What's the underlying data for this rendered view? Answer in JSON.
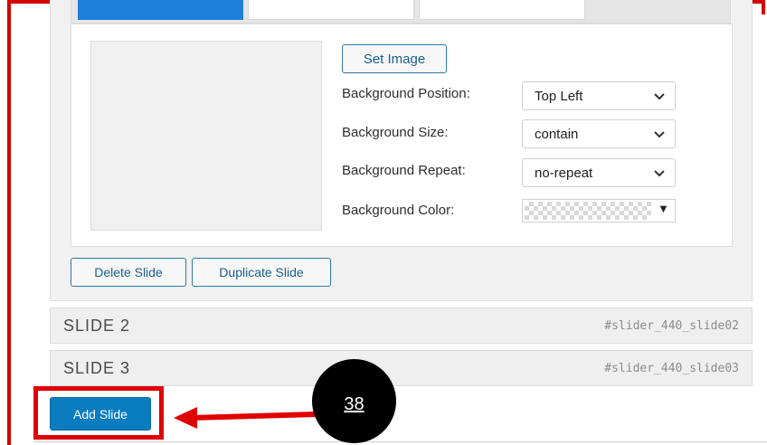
{
  "buttons": {
    "set_image": "Set Image",
    "delete_slide": "Delete Slide",
    "duplicate_slide": "Duplicate Slide",
    "add_slide": "Add Slide"
  },
  "fields": [
    {
      "label": "Background Position:",
      "value": "Top Left"
    },
    {
      "label": "Background Size:",
      "value": "contain"
    },
    {
      "label": "Background Repeat:",
      "value": "no-repeat"
    },
    {
      "label": "Background Color:"
    }
  ],
  "slides": [
    {
      "title": "SLIDE 2",
      "id": "#slider_440_slide02"
    },
    {
      "title": "SLIDE 3",
      "id": "#slider_440_slide03"
    }
  ],
  "annotation": {
    "step_number": "38"
  },
  "colors": {
    "accent_blue": "#0a7cc0",
    "annotation_red": "#e00000",
    "tab_active": "#1e7fd8"
  }
}
